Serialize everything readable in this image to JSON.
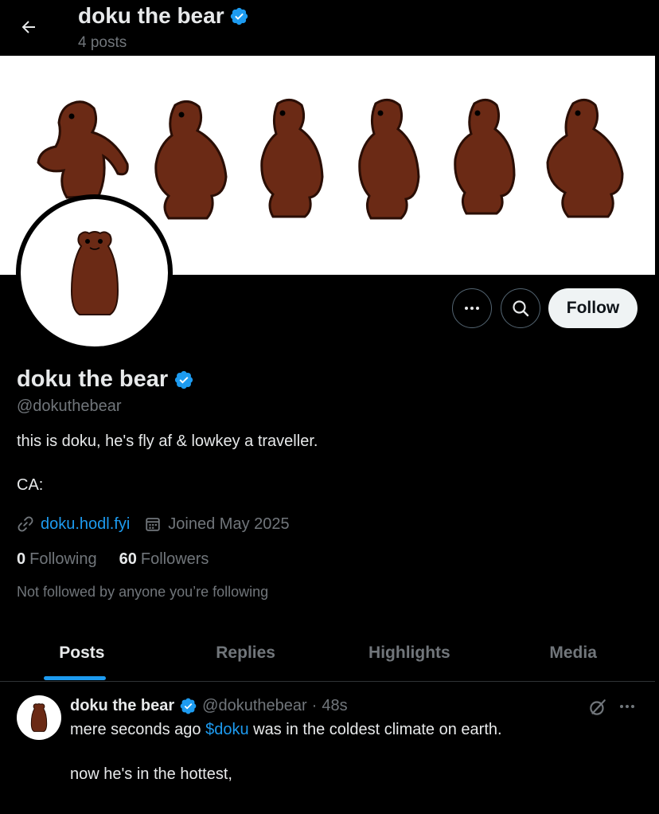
{
  "header": {
    "title": "doku the bear",
    "posts_count": "4 posts"
  },
  "profile": {
    "name": "doku the bear",
    "handle": "@dokuthebear",
    "bio": "this is doku, he's fly af & lowkey a traveller.",
    "ca_label": "CA:",
    "website": "doku.hodl.fyi",
    "joined": "Joined May 2025",
    "following_count": "0",
    "following_label": "Following",
    "followers_count": "60",
    "followers_label": "Followers",
    "not_followed": "Not followed by anyone you’re following",
    "follow_label": "Follow"
  },
  "tabs": [
    {
      "label": "Posts"
    },
    {
      "label": "Replies"
    },
    {
      "label": "Highlights"
    },
    {
      "label": "Media"
    }
  ],
  "post": {
    "name": "doku the bear",
    "handle": "@dokuthebear",
    "separator": "·",
    "time": "48s",
    "text1_before": "mere seconds ago ",
    "cashtag": "$doku",
    "text1_after": " was in the coldest climate on earth.",
    "text2": "now he's in the hottest,",
    "text3": ""
  },
  "colors": {
    "accent": "#1d9bf0",
    "bear_brown": "#6b2a15",
    "background": "#000000",
    "muted_text": "#71767b"
  },
  "icons": [
    "back-arrow-icon",
    "verified-badge-icon",
    "more-icon",
    "search-icon",
    "link-icon",
    "calendar-icon",
    "grok-icon"
  ]
}
